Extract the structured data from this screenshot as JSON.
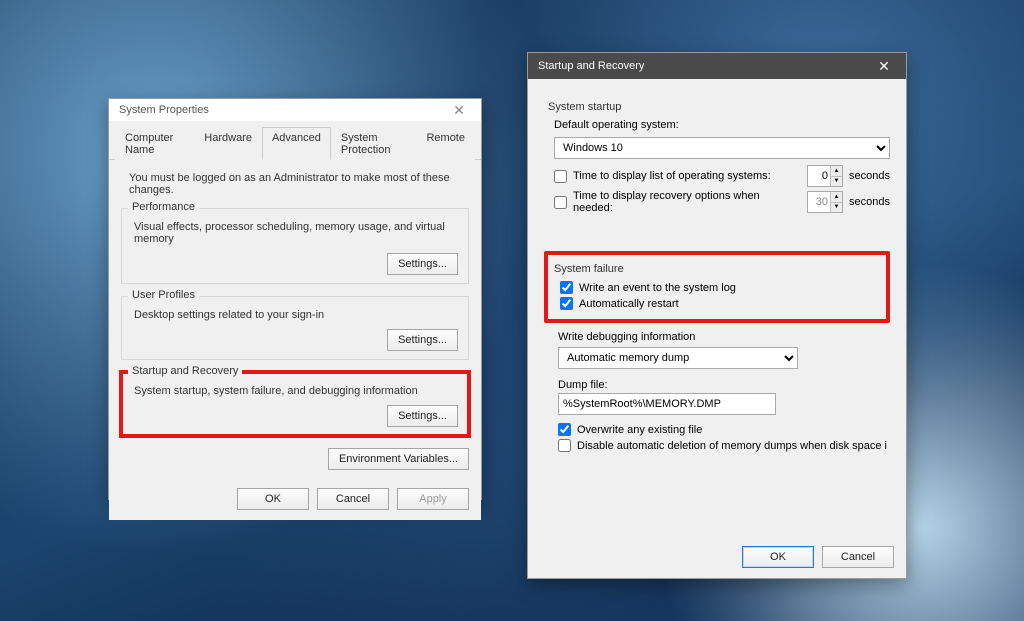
{
  "props": {
    "title": "System Properties",
    "tabs": [
      "Computer Name",
      "Hardware",
      "Advanced",
      "System Protection",
      "Remote"
    ],
    "note": "You must be logged on as an Administrator to make most of these changes.",
    "perf": {
      "label": "Performance",
      "desc": "Visual effects, processor scheduling, memory usage, and virtual memory",
      "btn": "Settings..."
    },
    "profiles": {
      "label": "User Profiles",
      "desc": "Desktop settings related to your sign-in",
      "btn": "Settings..."
    },
    "startup": {
      "label": "Startup and Recovery",
      "desc": "System startup, system failure, and debugging information",
      "btn": "Settings..."
    },
    "env_btn": "Environment Variables...",
    "ok": "OK",
    "cancel": "Cancel",
    "apply": "Apply"
  },
  "recov": {
    "title": "Startup and Recovery",
    "sys_startup": "System startup",
    "default_os_label": "Default operating system:",
    "default_os_value": "Windows 10",
    "time_list_label": "Time to display list of operating systems:",
    "time_list_val": "0",
    "time_recov_label": "Time to display recovery options when needed:",
    "time_recov_val": "30",
    "seconds": "seconds",
    "sys_failure": "System failure",
    "write_event": "Write an event to the system log",
    "auto_restart": "Automatically restart",
    "write_debug": "Write debugging information",
    "debug_value": "Automatic memory dump",
    "dump_file_label": "Dump file:",
    "dump_file_value": "%SystemRoot%\\MEMORY.DMP",
    "overwrite": "Overwrite any existing file",
    "disable_delete": "Disable automatic deletion of memory dumps when disk space is low",
    "ok": "OK",
    "cancel": "Cancel"
  }
}
